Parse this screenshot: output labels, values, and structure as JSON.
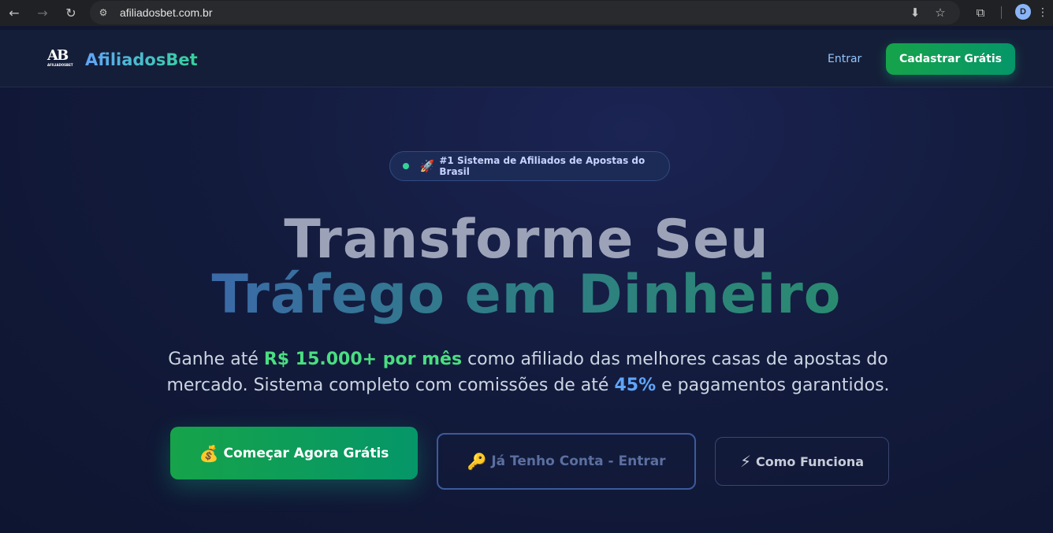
{
  "browser": {
    "url": "afiliadosbet.com.br",
    "profile_initial": "D",
    "icons": {
      "back": "←",
      "forward": "→",
      "reload": "↻",
      "site_info": "⚙",
      "install": "⬇",
      "bookmark": "☆",
      "extensions": "⧉",
      "menu": "⋮"
    }
  },
  "header": {
    "logo_letters": "AB",
    "logo_small": "AFILIADOSBET",
    "brand": "AfiliadosBet",
    "login_label": "Entrar",
    "signup_label": "Cadastrar Grátis"
  },
  "hero": {
    "badge_icon": "🚀",
    "badge_text": "#1 Sistema de Afiliados de Apostas do Brasil",
    "title_line1": "Transforme Seu",
    "title_line2": "Tráfego em Dinheiro",
    "subtitle": {
      "part1": "Ganhe até ",
      "highlight1": "R$ 15.000+ por mês",
      "part2": " como afiliado das melhores casas de apostas do mercado. Sistema completo com comissões de até ",
      "highlight2": "45%",
      "part3": " e pagamentos garantidos."
    },
    "cta_primary": {
      "icon": "💰",
      "label": "Começar Agora Grátis"
    },
    "cta_secondary": {
      "icon": "🔑",
      "label": "Já Tenho Conta - Entrar"
    },
    "cta_tertiary": {
      "icon": "⚡",
      "label": "Como Funciona"
    }
  },
  "colors": {
    "accent_green": "#16a34a",
    "accent_blue": "#60a5fa",
    "background": "#131b3d"
  }
}
